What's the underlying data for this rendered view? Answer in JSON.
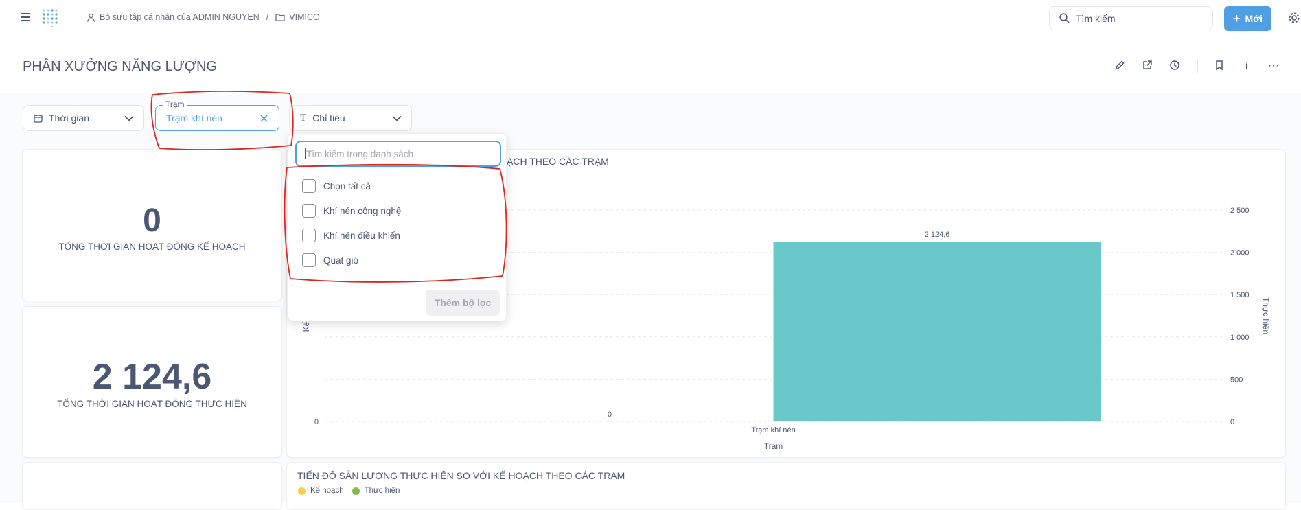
{
  "nav": {
    "breadcrumb_collection": "Bộ sưu tập cá nhân của ADMIN NGUYEN",
    "breadcrumb_separator": "/",
    "breadcrumb_folder": "VIMICO",
    "search_label": "Tìm kiếm",
    "new_label": "Mới"
  },
  "dashboard": {
    "title": "PHÂN XƯỞNG NĂNG LƯỢNG"
  },
  "filters": {
    "time_label": "Thời gian",
    "station_field_label": "Trạm",
    "station_value": "Trạm khí nén",
    "metric_label": "Chỉ tiêu"
  },
  "dropdown": {
    "search_placeholder": "Tìm kiếm trong danh sách",
    "options": [
      {
        "label": "Chọn tất cả",
        "checked": false
      },
      {
        "label": "Khí nén công nghệ",
        "checked": false
      },
      {
        "label": "Khí nén điều khiển",
        "checked": false
      },
      {
        "label": "Quạt gió",
        "checked": false
      }
    ],
    "add_button": "Thêm bộ lọc"
  },
  "kpis": [
    {
      "value": "0",
      "label": "TỔNG THỜI GIAN HOẠT ĐỘNG KẾ HOẠCH"
    },
    {
      "value": "2 124,6",
      "label": "TỔNG THỜI GIAN HOẠT ĐỘNG THỰC HIỆN"
    }
  ],
  "chart1": {
    "title_visible": "ẠCH THEO CÁC TRẠM",
    "left_axis_label_visible": "Kế",
    "right_axis_label": "Thực hiện",
    "xlabel": "Trạm",
    "right_ticks": [
      "2 500",
      "2 000",
      "1 500",
      "1 000",
      "500",
      "0"
    ],
    "left_tick": "0",
    "planned_label": "0",
    "actual_label": "2 124,6",
    "bar_color": "#69c8c8"
  },
  "chart2": {
    "title": "TIẾN ĐỘ SẢN LƯỢNG THỰC HIỆN SO VỚI KẾ HOẠCH THEO CÁC TRẠM",
    "legend": [
      {
        "name": "Kế hoạch",
        "color": "#f9cf48"
      },
      {
        "name": "Thực hiện",
        "color": "#84bb4c"
      }
    ]
  },
  "chart_data": {
    "type": "bar",
    "categories": [
      "Trạm khí nén"
    ],
    "series": [
      {
        "name": "Kế hoạch",
        "values": [
          0
        ],
        "axis": "left"
      },
      {
        "name": "Thực hiện",
        "values": [
          2124.6
        ],
        "axis": "right"
      }
    ],
    "xlabel": "Trạm",
    "ylabel_right": "Thực hiện",
    "ylim_right": [
      0,
      2500
    ],
    "grid": true
  },
  "colors": {
    "accent": "#509ee3",
    "annotation": "#e0241e"
  }
}
